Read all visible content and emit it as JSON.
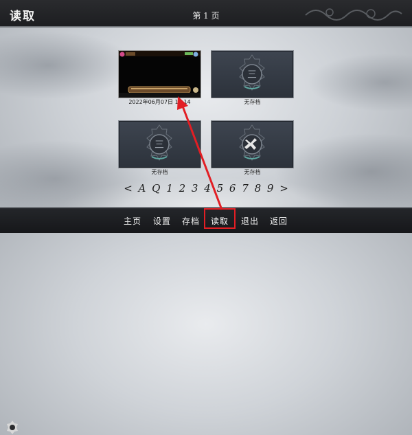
{
  "header": {
    "title": "读取",
    "page_indicator": "第 1 页"
  },
  "slots": [
    {
      "label": "2022年06月07日 15:14",
      "state": "saved"
    },
    {
      "label": "无存档",
      "state": "empty",
      "emblem": "three"
    },
    {
      "label": "无存档",
      "state": "empty",
      "emblem": "three"
    },
    {
      "label": "无存档",
      "state": "empty",
      "emblem": "cross"
    }
  ],
  "pagination": {
    "prev": "<",
    "auto": "A",
    "quick": "Q",
    "pages": [
      "1",
      "2",
      "3",
      "4",
      "5",
      "6",
      "7",
      "8",
      "9"
    ],
    "next": ">",
    "current_page": "1"
  },
  "menu": {
    "items": [
      {
        "label": "主页"
      },
      {
        "label": "设置"
      },
      {
        "label": "存档"
      },
      {
        "label": "读取",
        "active": true
      },
      {
        "label": "退出"
      },
      {
        "label": "返回"
      }
    ]
  },
  "colors": {
    "highlight": "#e21e24",
    "arrow": "#e21e24",
    "bar": "#1d1e21"
  }
}
